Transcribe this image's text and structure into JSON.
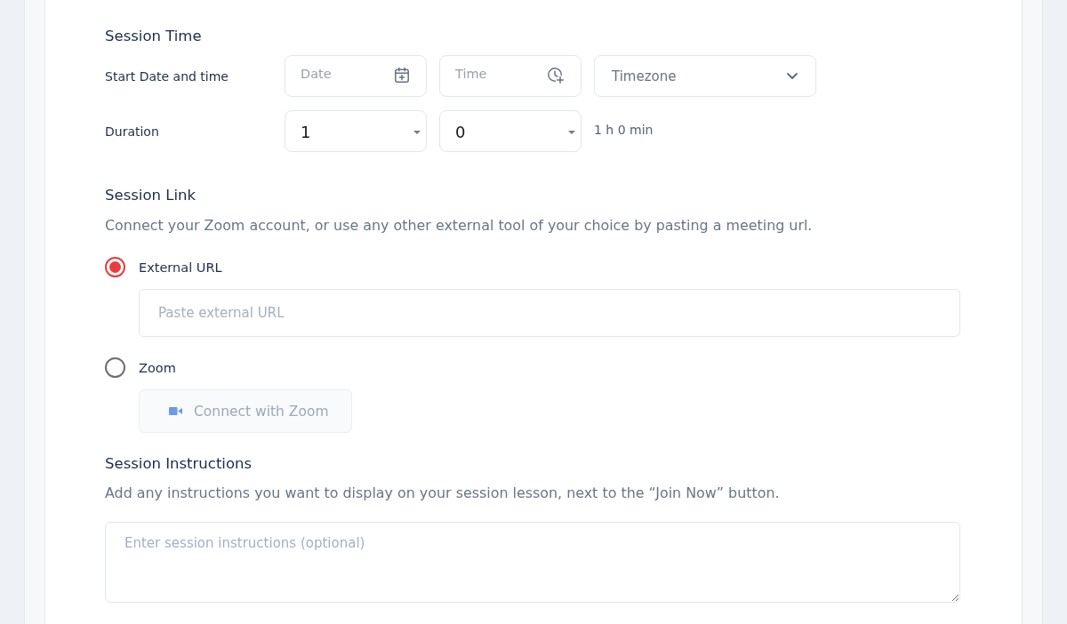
{
  "session_time": {
    "title": "Session Time",
    "start": {
      "label": "Start Date and time",
      "date": {
        "placeholder": "Date"
      },
      "time": {
        "placeholder": "Time"
      },
      "timezone": {
        "placeholder": "Timezone"
      }
    },
    "duration": {
      "label": "Duration",
      "hours": {
        "value": "1"
      },
      "minutes": {
        "value": "0"
      },
      "summary": "1 h 0 min"
    }
  },
  "session_link": {
    "title": "Session Link",
    "description": "Connect your Zoom account, or use any other external tool of your choice by pasting a meeting url.",
    "options": [
      {
        "kind": "url",
        "label": "External URL",
        "selected": true,
        "field": {
          "placeholder": "Paste external URL"
        }
      },
      {
        "kind": "zoom",
        "label": "Zoom",
        "selected": false,
        "button": {
          "label": "Connect with Zoom",
          "disabled": true
        }
      }
    ]
  },
  "session_instructions": {
    "title": "Session Instructions",
    "description": "Add any instructions you want to display on your session lesson, next to the “Join Now” button.",
    "field": {
      "placeholder": "Enter session instructions (optional)"
    }
  }
}
